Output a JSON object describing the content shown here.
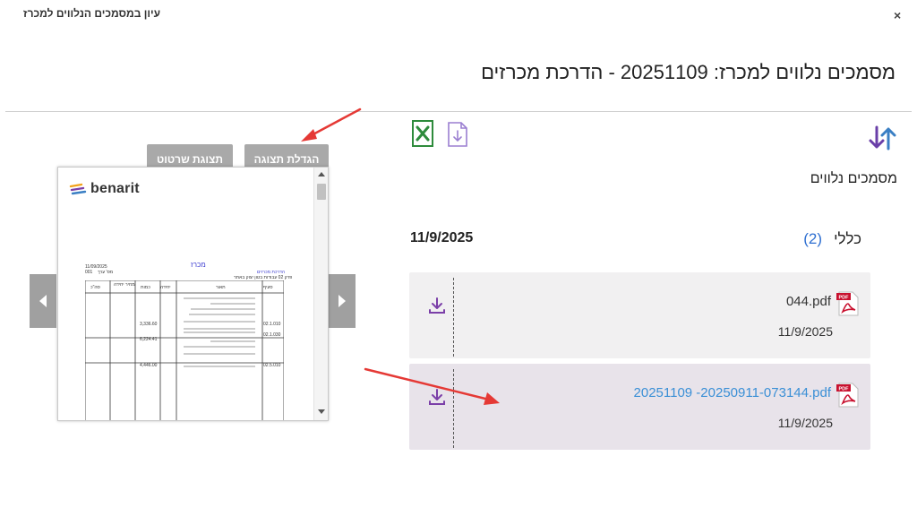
{
  "window": {
    "title": "עיון במסמכים הנלווים למכרז",
    "close_label": "×"
  },
  "heading": "מסמכים נלווים למכרז: 20251109 - הדרכת מכרזים",
  "section_title": "מסמכים נלווים",
  "toolbar": {
    "enlarge_label": "הגדלת תצוגה",
    "drawing_label": "תצוגת שרטוט"
  },
  "group": {
    "label": "כללי",
    "count": "(2)",
    "date": "11/9/2025"
  },
  "documents": [
    {
      "name": "044.pdf",
      "date": "11/9/2025",
      "selected": false
    },
    {
      "name": "20251109 -20250911-073144.pdf",
      "date": "11/9/2025",
      "selected": true
    }
  ],
  "preview": {
    "logo_text": "benarit",
    "doc_title": "מכרז",
    "lines": {
      "date": "11/09/2025",
      "ref": "מס' ערך",
      "ref_num": "001",
      "topic": "הדרכת מכרזים",
      "sub": "פרק 02 עבודות בטון יצוק באתר",
      "col_code": "סעיף",
      "col_desc": "תאור",
      "col_unit": "יחידה",
      "col_qty": "כמות",
      "col_price": "מחיר יחידה",
      "col_total": "סה\"כ",
      "row1_code": "02.1.010",
      "row1_qty": "3,336.60",
      "row2_code": "02.1.030",
      "row2_qty": "6,224.41",
      "row3_code": "02.5.010",
      "row3_qty": "4,446.00"
    }
  },
  "colors": {
    "accent_link": "#3a8fd6",
    "count_blue": "#2e6fd1",
    "button_gray": "#a9a9a9",
    "annotation_red": "#e53935"
  }
}
